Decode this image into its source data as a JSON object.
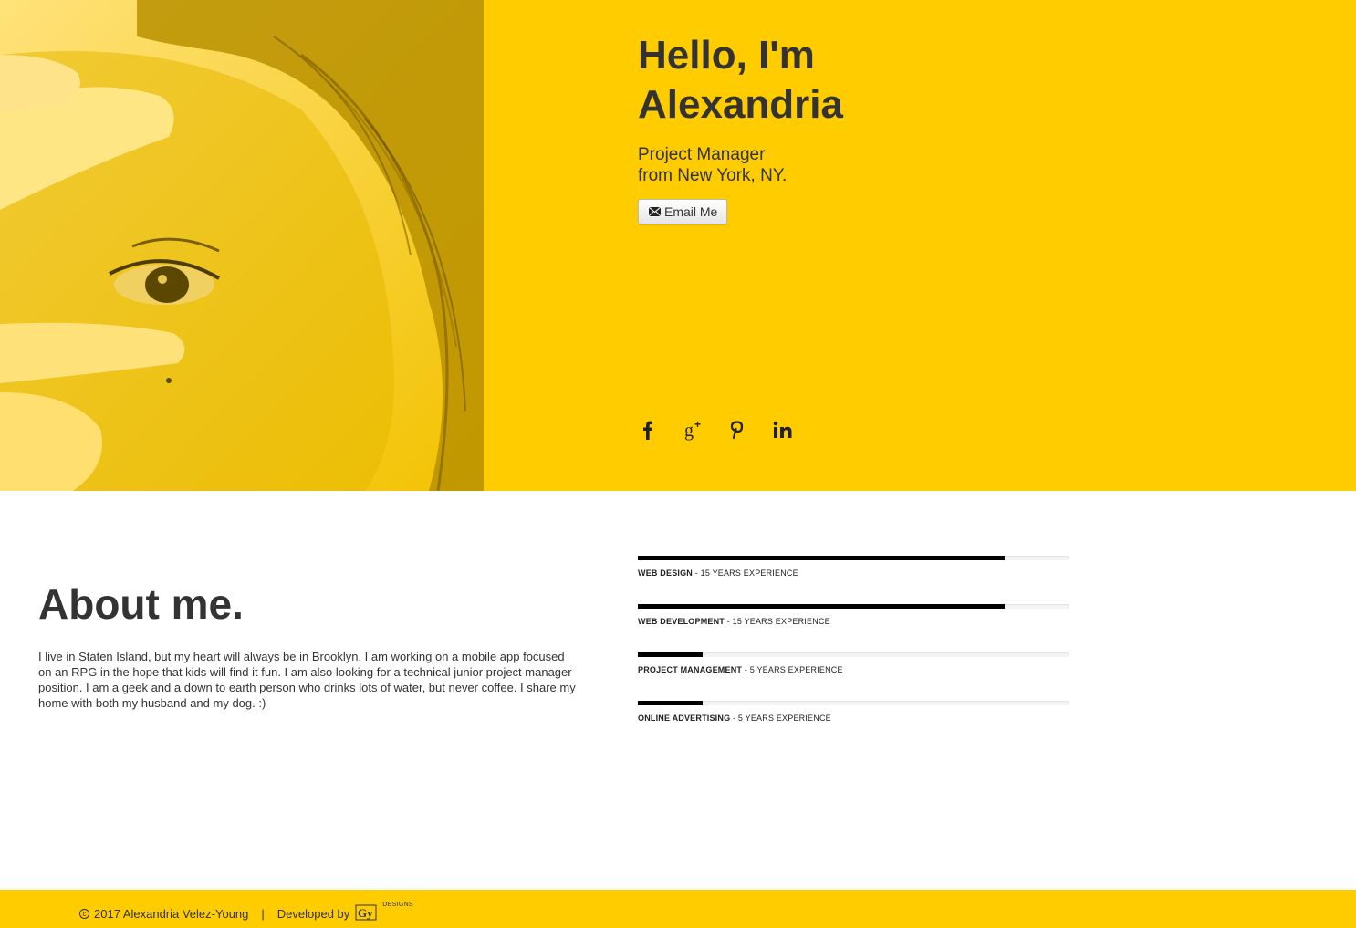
{
  "hero": {
    "title_line1": "Hello, I'm",
    "title_line2": "Alexandria",
    "subtitle_line1": "Project Manager",
    "subtitle_line2": "from New York, NY.",
    "email_button": "Email Me",
    "background_color": "#ffcc00"
  },
  "social": [
    {
      "name": "facebook-icon"
    },
    {
      "name": "google-plus-icon"
    },
    {
      "name": "pinterest-icon"
    },
    {
      "name": "linkedin-icon"
    }
  ],
  "about": {
    "title": "About me.",
    "text": "I live in Staten Island, but my heart will always be in Brooklyn. I am working on a mobile app focused on an RPG in the hope that kids will find it fun. I am also looking for a technical junior project manager position. I am a geek and a down to earth person who drinks lots of water, but never coffee. I share my home with both my husband and my dog. :)"
  },
  "skills": [
    {
      "name": "WEB DESIGN",
      "detail": "15 YEARS EXPERIENCE",
      "level": 0.85
    },
    {
      "name": "WEB DEVELOPMENT",
      "detail": "15 YEARS EXPERIENCE",
      "level": 0.85
    },
    {
      "name": "PROJECT MANAGEMENT",
      "detail": "5 YEARS EXPERIENCE",
      "level": 0.15
    },
    {
      "name": "ONLINE ADVERTISING",
      "detail": "5 YEARS EXPERIENCE",
      "level": 0.15
    }
  ],
  "footer": {
    "copyright": "2017 Alexandria Velez-Young",
    "separator": "|",
    "developed_by": "Developed by",
    "logo_text": "Gy",
    "logo_suffix": "DESIGNS"
  }
}
